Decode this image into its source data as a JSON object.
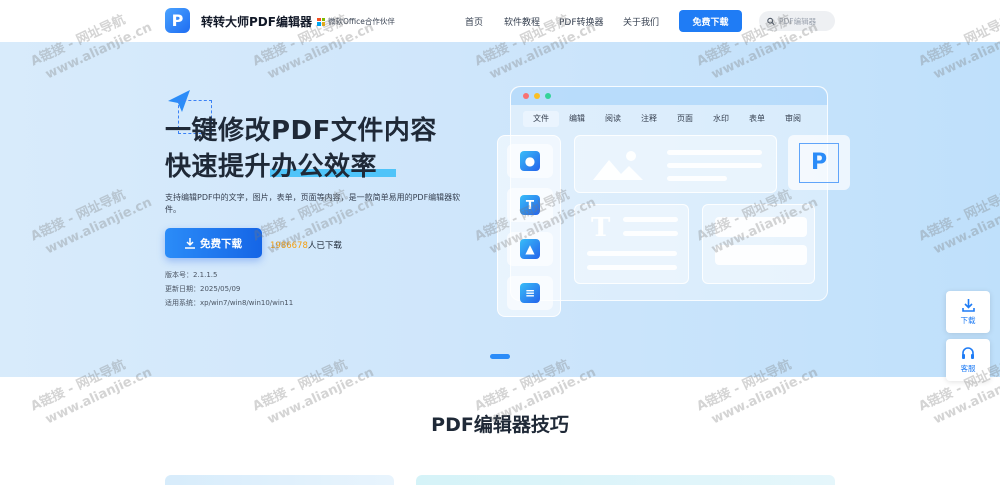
{
  "header": {
    "logo_letter": "P",
    "brand": "转转大师PDF编辑器",
    "partner_tag": "微软Office合作伙伴",
    "nav": [
      "首页",
      "软件教程",
      "PDF转换器",
      "关于我们"
    ],
    "download_button": "免费下载",
    "search_placeholder": "PDF编辑器"
  },
  "hero": {
    "title_line1": "一键修改PDF文件内容",
    "title_line2": "快速提升办公效率",
    "description": "支持编辑PDF中的文字，图片，表单，页面等内容，是一款简单易用的PDF编辑器软件。",
    "download_button": "免费下载",
    "download_count": "1986678",
    "download_suffix": "人已下载",
    "version": "版本号：2.1.1.5",
    "updated": "更新日期：2025/05/09",
    "system": "适用系统：xp/win7/win8/win10/win11",
    "illustration_tabs": [
      "文件",
      "编辑",
      "阅读",
      "注释",
      "页面",
      "水印",
      "表单",
      "审阅"
    ],
    "active_tab": "文件",
    "illustration_text_icon": "T",
    "panel_text_icon": "T",
    "illustration_logo": "P"
  },
  "float": {
    "download_label": "下载",
    "service_label": "客服"
  },
  "section": {
    "title": "PDF编辑器技巧"
  },
  "watermark": {
    "line1": "A链接 - 网址导航",
    "line2": "www.alianjie.cn"
  },
  "colors": {
    "accent": "#1f7cf5",
    "hero_bg": "#cfe6fb",
    "highlight": "#f59e0b"
  }
}
